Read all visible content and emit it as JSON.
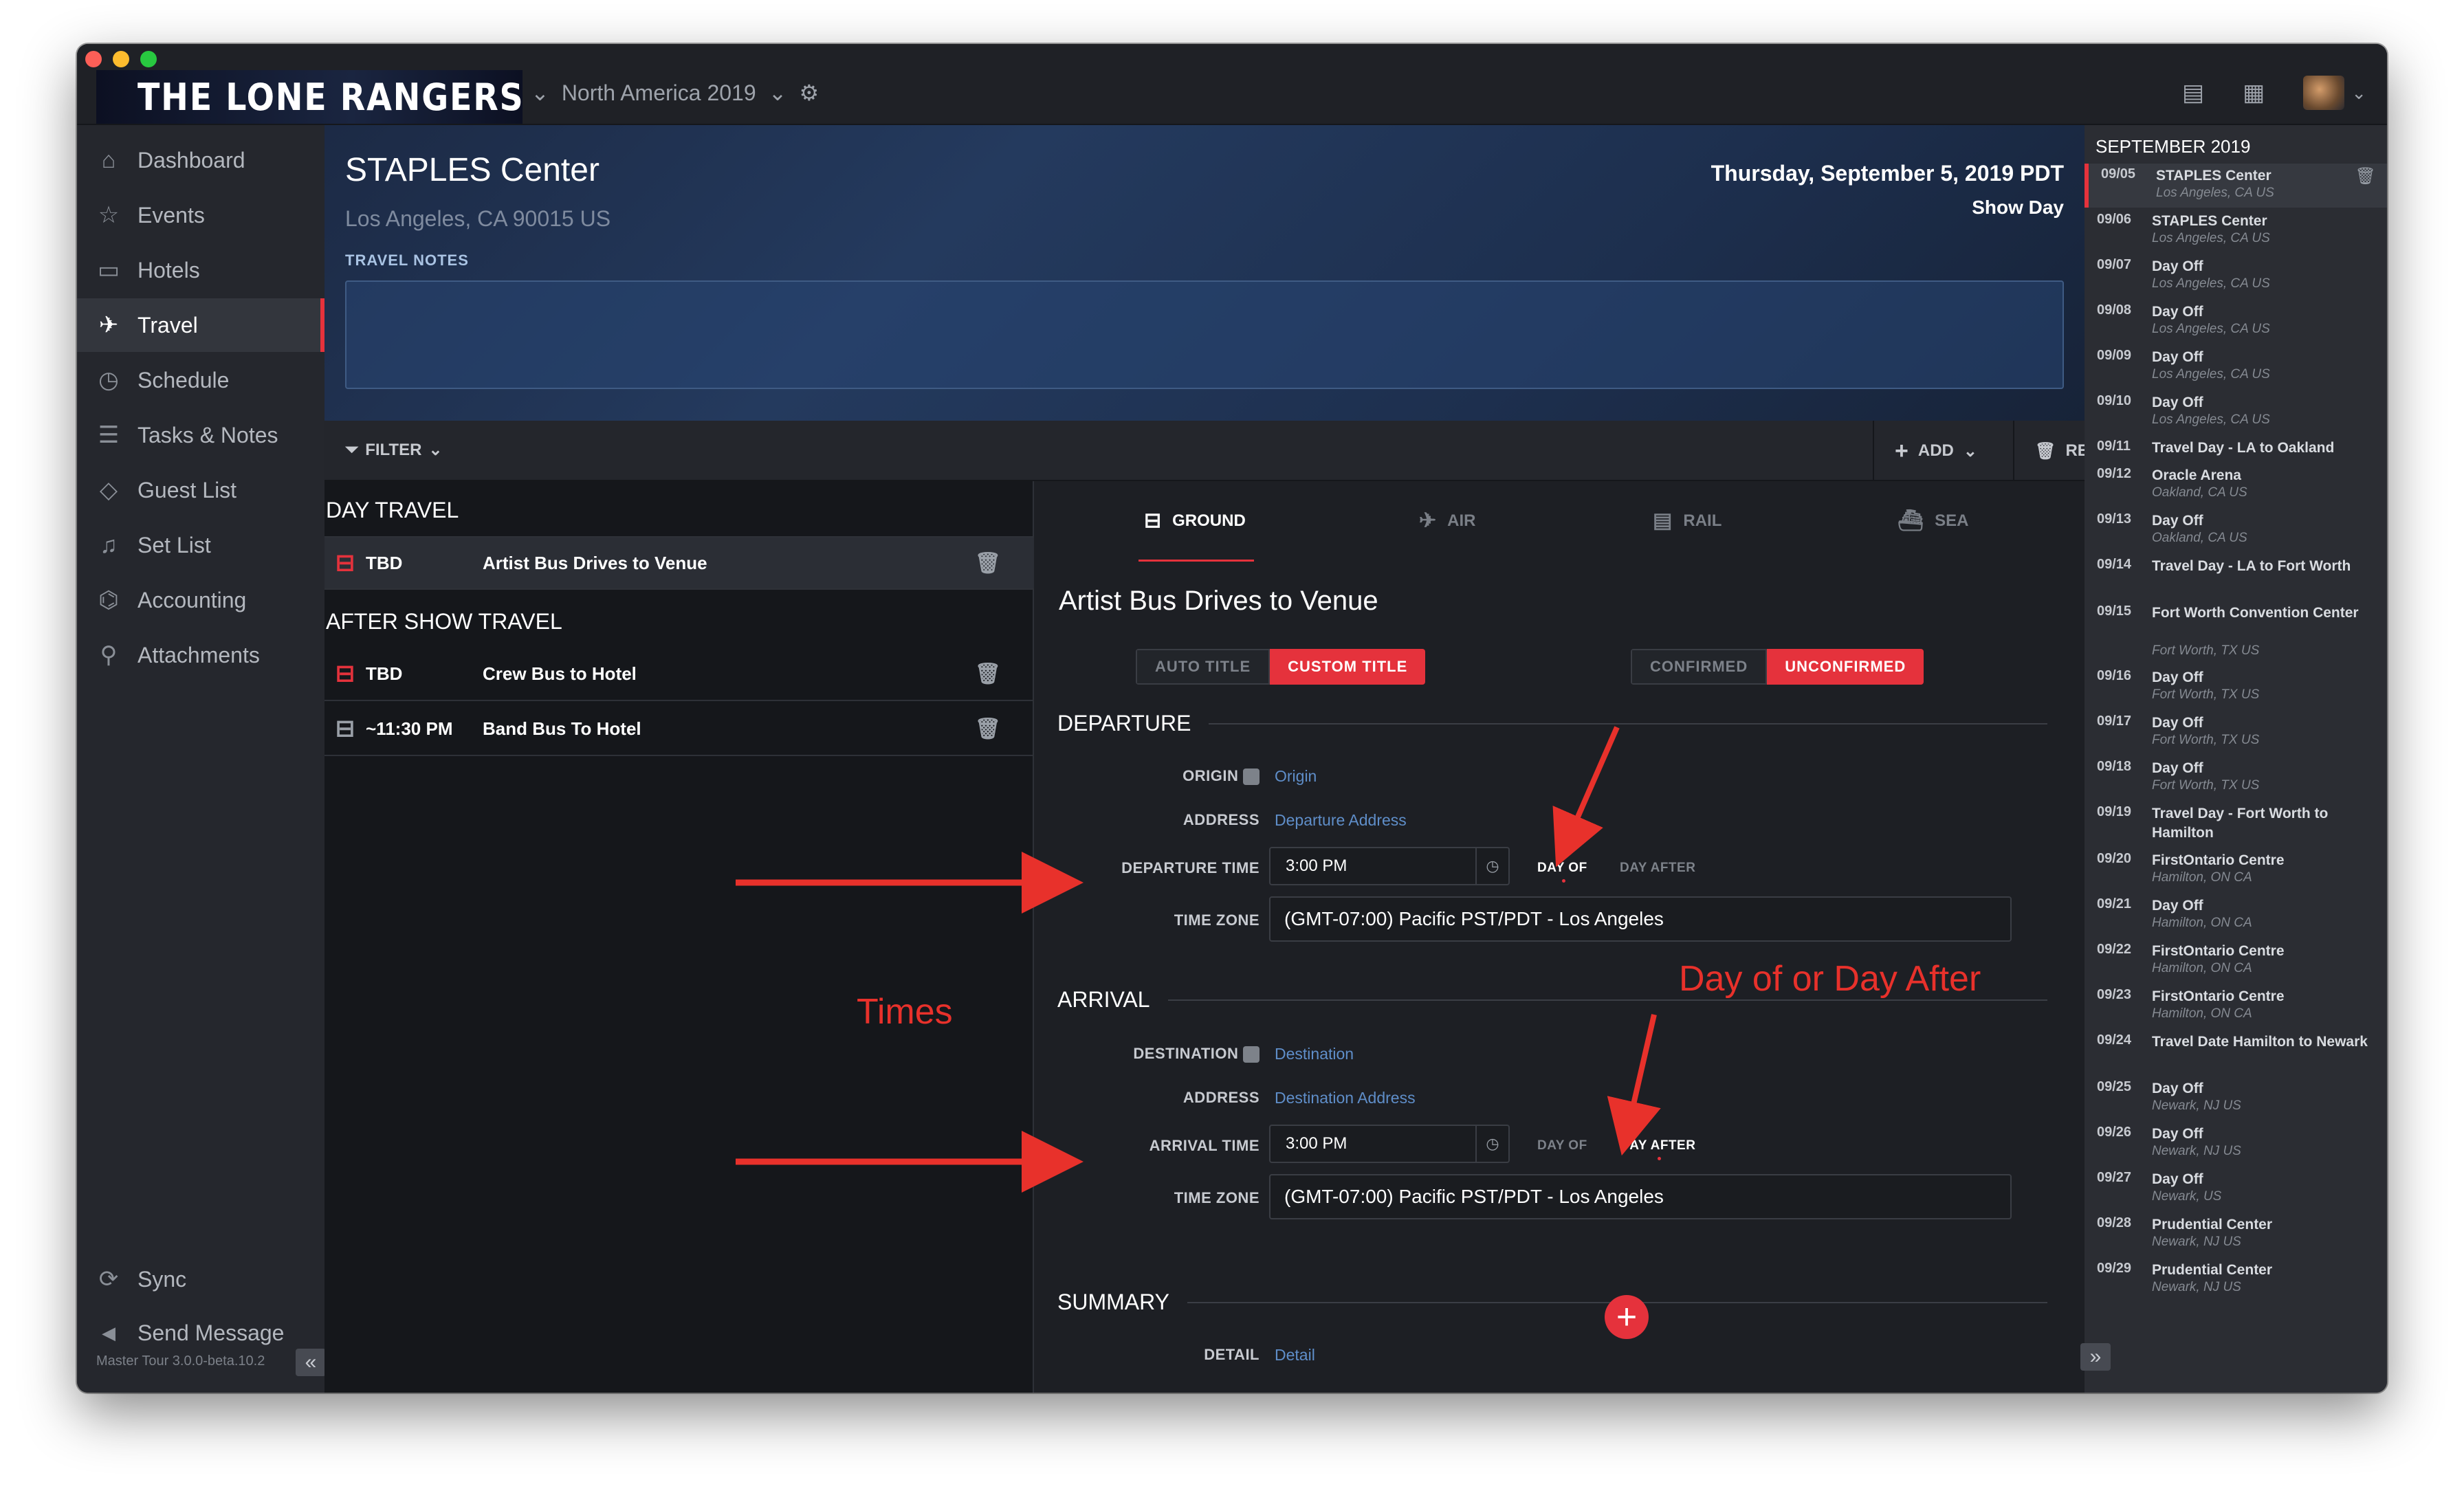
{
  "app": {
    "band_name": "THE LONE RANGERS",
    "tour_name": "North America 2019",
    "version": "Master Tour 3.0.0-beta.10.2"
  },
  "sidebar": {
    "items": [
      {
        "label": "Dashboard",
        "icon": "home-icon",
        "glyph": "⌂"
      },
      {
        "label": "Events",
        "icon": "star-icon",
        "glyph": "☆"
      },
      {
        "label": "Hotels",
        "icon": "hotel-icon",
        "glyph": "▭"
      },
      {
        "label": "Travel",
        "icon": "plane-icon",
        "glyph": "✈"
      },
      {
        "label": "Schedule",
        "icon": "schedule-icon",
        "glyph": "◷"
      },
      {
        "label": "Tasks & Notes",
        "icon": "tasks-icon",
        "glyph": "☰"
      },
      {
        "label": "Guest List",
        "icon": "ticket-icon",
        "glyph": "◇"
      },
      {
        "label": "Set List",
        "icon": "music-note-icon",
        "glyph": "♫"
      },
      {
        "label": "Accounting",
        "icon": "money-icon",
        "glyph": "⌬"
      },
      {
        "label": "Attachments",
        "icon": "paperclip-icon",
        "glyph": "⚲"
      }
    ],
    "bottom": [
      {
        "label": "Sync",
        "icon": "sync-icon",
        "glyph": "⟳"
      },
      {
        "label": "Send Message",
        "icon": "megaphone-icon",
        "glyph": "📣"
      }
    ]
  },
  "header": {
    "venue": "STAPLES Center",
    "address": "Los Angeles, CA 90015 US",
    "notes_label": "TRAVEL NOTES",
    "date": "Thursday, September 5, 2019 PDT",
    "day_type": "Show Day"
  },
  "toolbar": {
    "filter": "FILTER",
    "add": "ADD",
    "remove": "REMOVE"
  },
  "travel_list": {
    "day_travel_heading": "DAY TRAVEL",
    "after_show_heading": "AFTER SHOW TRAVEL",
    "day_travel": [
      {
        "time": "TBD",
        "title": "Artist Bus Drives to Venue"
      }
    ],
    "after_show": [
      {
        "time": "TBD",
        "title": "Crew Bus to Hotel"
      },
      {
        "time": "~11:30 PM",
        "title": "Band Bus To Hotel"
      }
    ]
  },
  "detail": {
    "modes": [
      "GROUND",
      "AIR",
      "RAIL",
      "SEA"
    ],
    "title": "Artist Bus Drives to Venue",
    "auto_title": "AUTO TITLE",
    "custom_title": "CUSTOM TITLE",
    "confirmed": "CONFIRMED",
    "unconfirmed": "UNCONFIRMED",
    "departure": {
      "heading": "DEPARTURE",
      "origin_label": "ORIGIN",
      "origin_placeholder": "Origin",
      "address_label": "ADDRESS",
      "address_placeholder": "Departure Address",
      "time_label": "DEPARTURE TIME",
      "time_value": "3:00 PM",
      "day_of": "DAY OF",
      "day_after": "DAY AFTER",
      "tz_label": "TIME ZONE",
      "tz_value": "(GMT-07:00) Pacific PST/PDT - Los Angeles"
    },
    "arrival": {
      "heading": "ARRIVAL",
      "dest_label": "DESTINATION",
      "dest_placeholder": "Destination",
      "address_label": "ADDRESS",
      "address_placeholder": "Destination Address",
      "time_label": "ARRIVAL TIME",
      "time_value": "3:00 PM",
      "day_of": "DAY OF",
      "day_after": "DAY AFTER",
      "tz_label": "TIME ZONE",
      "tz_value": "(GMT-07:00) Pacific PST/PDT - Los Angeles"
    },
    "summary": {
      "heading": "SUMMARY",
      "detail_label": "DETAIL",
      "detail_placeholder": "Detail"
    }
  },
  "calendar": {
    "month": "SEPTEMBER 2019",
    "days": [
      {
        "date": "09/05",
        "title": "STAPLES Center",
        "sub": "Los Angeles, CA US"
      },
      {
        "date": "09/06",
        "title": "STAPLES Center",
        "sub": "Los Angeles, CA US"
      },
      {
        "date": "09/07",
        "title": "Day Off",
        "sub": "Los Angeles, CA US"
      },
      {
        "date": "09/08",
        "title": "Day Off",
        "sub": "Los Angeles, CA US"
      },
      {
        "date": "09/09",
        "title": "Day Off",
        "sub": "Los Angeles, CA US"
      },
      {
        "date": "09/10",
        "title": "Day Off",
        "sub": "Los Angeles, CA US"
      },
      {
        "date": "09/11",
        "title": "Travel Day - LA to Oakland",
        "sub": ""
      },
      {
        "date": "09/12",
        "title": "Oracle Arena",
        "sub": "Oakland, CA US"
      },
      {
        "date": "09/13",
        "title": "Day Off",
        "sub": "Oakland, CA US"
      },
      {
        "date": "09/14",
        "title": "Travel Day - LA to Fort Worth",
        "sub": ""
      },
      {
        "date": "09/15",
        "title": "Fort Worth Convention Center",
        "sub": "Fort Worth, TX US"
      },
      {
        "date": "09/16",
        "title": "Day Off",
        "sub": "Fort Worth, TX US"
      },
      {
        "date": "09/17",
        "title": "Day Off",
        "sub": "Fort Worth, TX US"
      },
      {
        "date": "09/18",
        "title": "Day Off",
        "sub": "Fort Worth, TX US"
      },
      {
        "date": "09/19",
        "title": "Travel Day - Fort Worth to Hamilton",
        "sub": ""
      },
      {
        "date": "09/20",
        "title": "FirstOntario Centre",
        "sub": "Hamilton, ON CA"
      },
      {
        "date": "09/21",
        "title": "Day Off",
        "sub": "Hamilton, ON CA"
      },
      {
        "date": "09/22",
        "title": "FirstOntario Centre",
        "sub": "Hamilton, ON CA"
      },
      {
        "date": "09/23",
        "title": "FirstOntario Centre",
        "sub": "Hamilton, ON CA"
      },
      {
        "date": "09/24",
        "title": "Travel Date Hamilton to Newark",
        "sub": ""
      },
      {
        "date": "09/25",
        "title": "Day Off",
        "sub": "Newark, NJ US"
      },
      {
        "date": "09/26",
        "title": "Day Off",
        "sub": "Newark, NJ US"
      },
      {
        "date": "09/27",
        "title": "Day Off",
        "sub": "Newark, US"
      },
      {
        "date": "09/28",
        "title": "Prudential Center",
        "sub": "Newark, NJ US"
      },
      {
        "date": "09/29",
        "title": "Prudential Center",
        "sub": "Newark, NJ US"
      }
    ]
  },
  "annotations": {
    "times": "Times",
    "day_of_or_after": "Day of or Day After",
    "color": "#e8312b"
  },
  "colors": {
    "accent": "#e5323c",
    "link": "#5f8ec9",
    "window_bg": "#1b1d22"
  }
}
